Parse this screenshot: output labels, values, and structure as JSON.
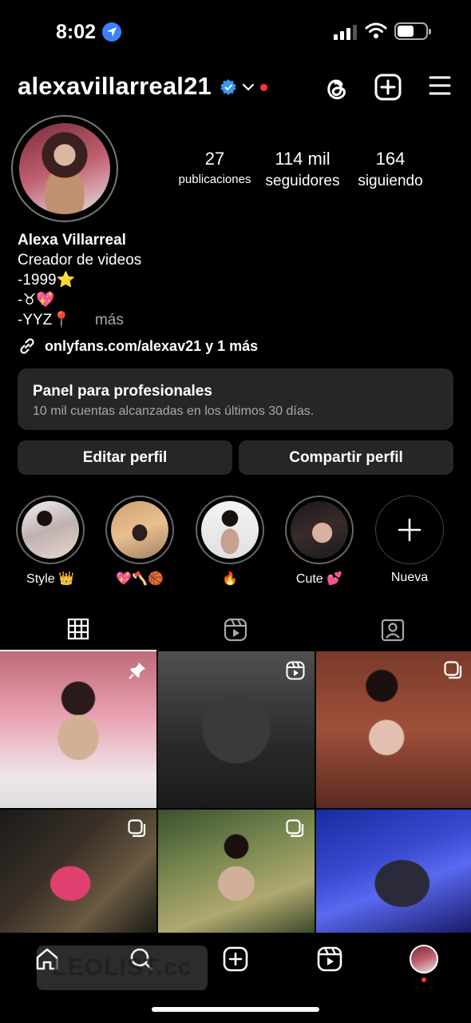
{
  "status_bar": {
    "time": "8:02"
  },
  "header": {
    "username": "alexavillarreal21"
  },
  "profile": {
    "stats": [
      {
        "value": "27",
        "label": "publicaciones"
      },
      {
        "value": "114 mil",
        "label": "seguidores"
      },
      {
        "value": "164",
        "label": "siguiendo"
      }
    ],
    "name": "Alexa Villarreal",
    "category": "Creador de videos",
    "bio_lines": [
      "-1999⭐",
      "-♉💖",
      "-YYZ📍"
    ],
    "more_label": "más",
    "link": "onlyfans.com/alexav21 y 1 más"
  },
  "professional_panel": {
    "title": "Panel para profesionales",
    "subtitle": "10 mil cuentas alcanzadas en los últimos 30 días."
  },
  "buttons": {
    "edit": "Editar perfil",
    "share": "Compartir perfil"
  },
  "highlights": [
    {
      "label": "Style 👑"
    },
    {
      "label": "💖🪓🏀"
    },
    {
      "label": "🔥"
    },
    {
      "label": "Cute 💕"
    },
    {
      "label": "Nueva"
    }
  ],
  "watermark": "LEOLIST.cc",
  "colors": {
    "background": "#000000",
    "surface": "#262626",
    "muted": "#a8a8a8",
    "verified": "#3897f0",
    "notification": "#ff3040"
  }
}
